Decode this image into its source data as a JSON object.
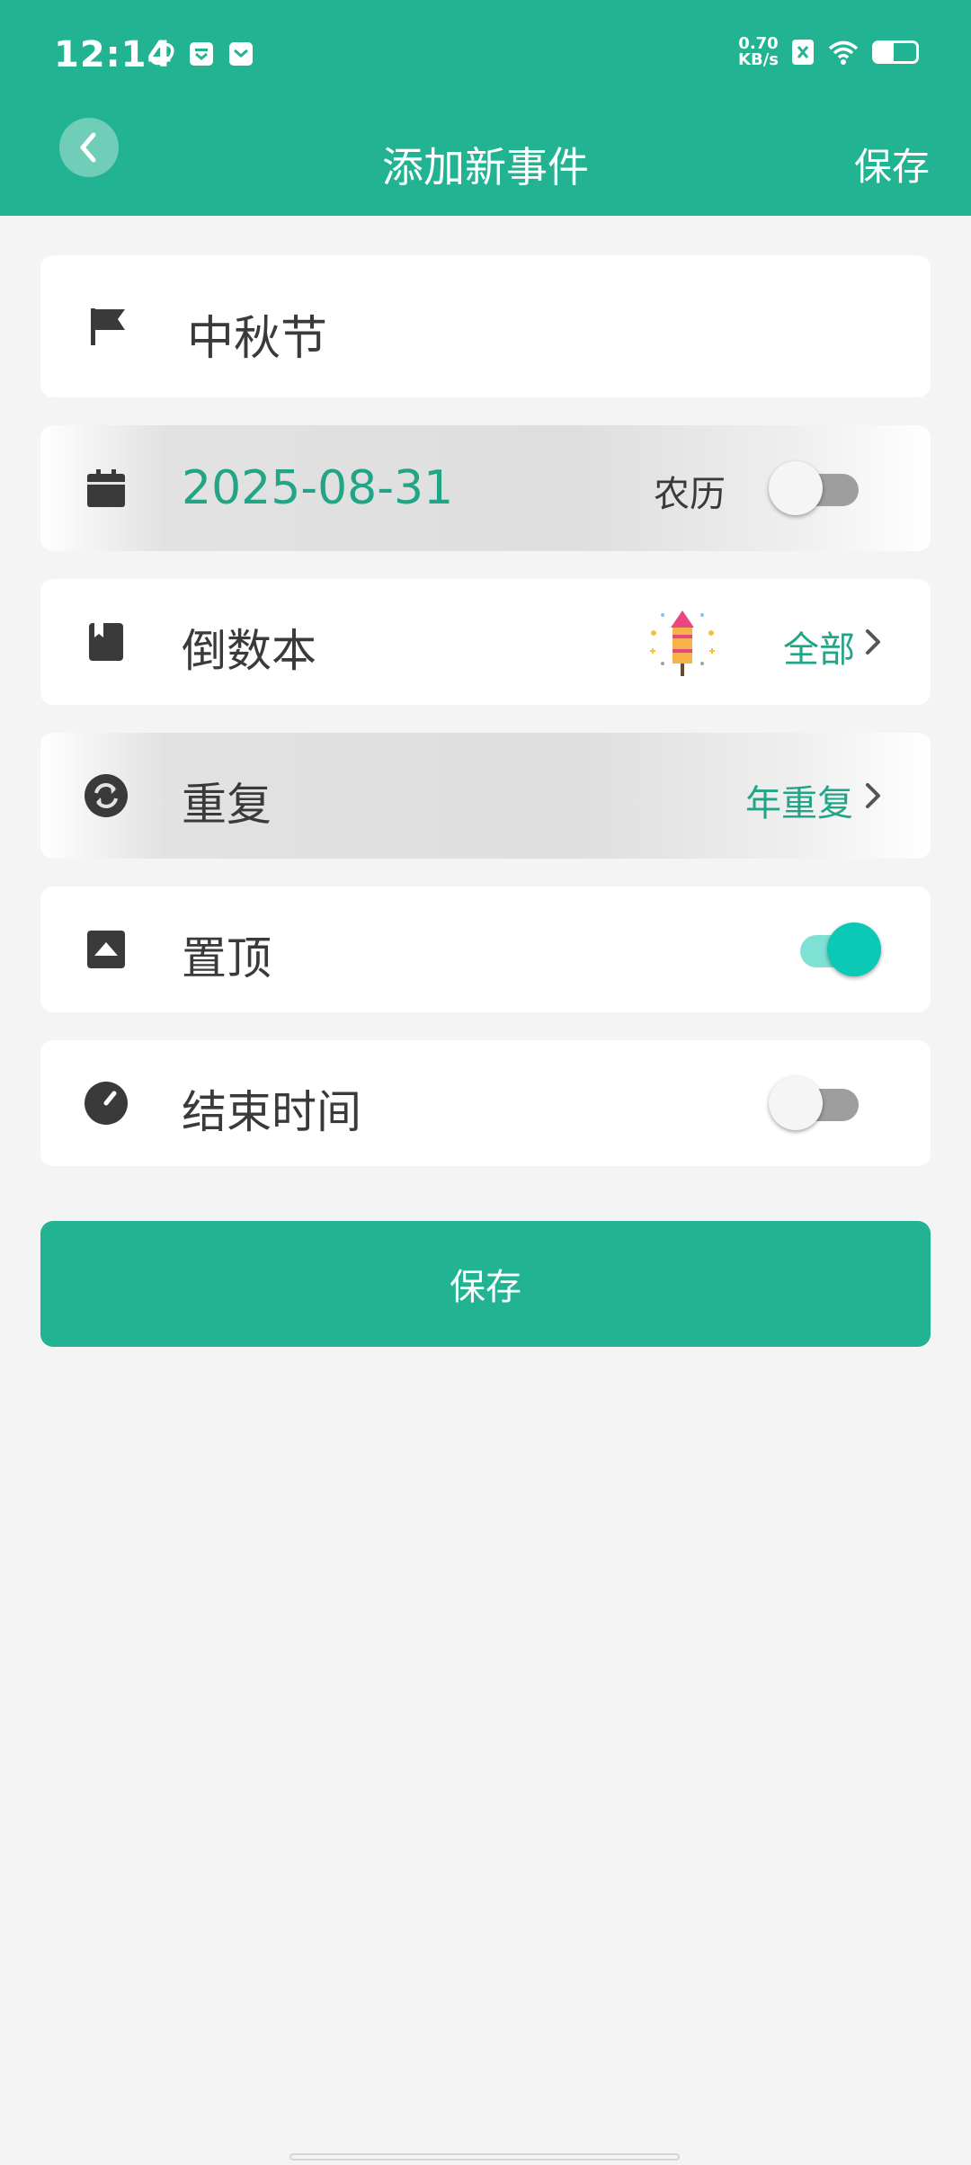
{
  "status_bar": {
    "time": "12:14",
    "net_speed_value": "0.70",
    "net_speed_unit": "KB/s",
    "battery_level": 0.45
  },
  "header": {
    "title": "添加新事件",
    "save_label": "保存"
  },
  "event_name": {
    "value": "中秋节"
  },
  "date_row": {
    "date": "2025-08-31",
    "lunar_label": "农历",
    "lunar_enabled": false
  },
  "book_row": {
    "label": "倒数本",
    "value": "全部"
  },
  "repeat_row": {
    "label": "重复",
    "value": "年重复"
  },
  "pin_row": {
    "label": "置顶",
    "enabled": true
  },
  "end_row": {
    "label": "结束时间",
    "enabled": false
  },
  "save_button": {
    "label": "保存"
  },
  "colors": {
    "primary": "#22b392",
    "accent_text": "#22a587",
    "toggle_on": "#0cc9b6"
  },
  "icons": {
    "name_row": "flag-icon",
    "date_row": "calendar-icon",
    "book_row": "book-icon",
    "book_badge": "rocket-firework-icon",
    "repeat_row": "repeat-icon",
    "pin_row": "pin-top-icon",
    "end_row": "clock-icon"
  }
}
